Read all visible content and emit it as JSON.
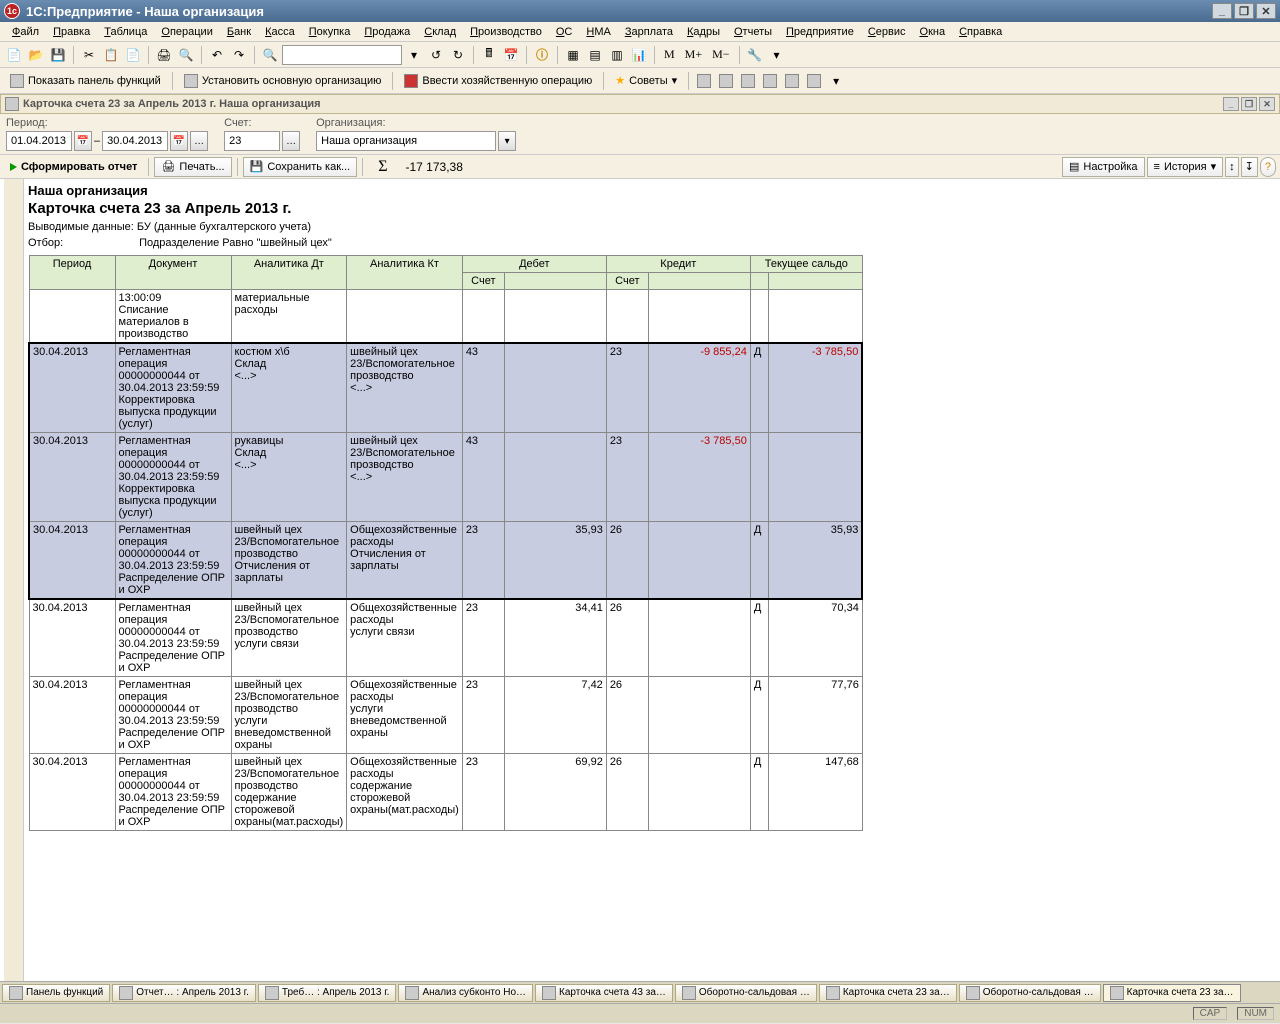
{
  "title": "1С:Предприятие - Наша организация",
  "menu": [
    "Файл",
    "Правка",
    "Таблица",
    "Операции",
    "Банк",
    "Касса",
    "Покупка",
    "Продажа",
    "Склад",
    "Производство",
    "ОС",
    "НМА",
    "Зарплата",
    "Кадры",
    "Отчеты",
    "Предприятие",
    "Сервис",
    "Окна",
    "Справка"
  ],
  "toolbar2": {
    "b1": "Показать панель функций",
    "b2": "Установить основную организацию",
    "b3": "Ввести хозяйственную операцию",
    "b4": "Советы"
  },
  "subtitle": "Карточка счета 23 за Апрель 2013 г. Наша организация",
  "params": {
    "periodLabel": "Период:",
    "from": "01.04.2013",
    "to": "30.04.2013",
    "accountLabel": "Счет:",
    "account": "23",
    "orgLabel": "Организация:",
    "org": "Наша организация"
  },
  "actions": {
    "form": "Сформировать отчет",
    "print": "Печать...",
    "save": "Сохранить как...",
    "sum": "-17 173,38",
    "settings": "Настройка",
    "history": "История"
  },
  "report": {
    "org": "Наша организация",
    "title": "Карточка счета 23 за Апрель 2013 г.",
    "meta1": "Выводимые данные:   БУ (данные бухгалтерского учета)",
    "filterLabel": "Отбор:",
    "filter": "Подразделение Равно \"швейный цех\""
  },
  "headers": {
    "period": "Период",
    "doc": "Документ",
    "adt": "Аналитика Дт",
    "akt": "Аналитика Кт",
    "debit": "Дебет",
    "credit": "Кредит",
    "bal": "Текущее сальдо",
    "acc": "Счет"
  },
  "rows": [
    {
      "sel": false,
      "period": "",
      "doc": "13:00:09\nСписание материалов в производство",
      "adt": "материальные расходы",
      "akt": "",
      "dacc": "",
      "dval": "",
      "cacc": "",
      "cval": "",
      "bdc": "",
      "bval": ""
    },
    {
      "sel": true,
      "period": "30.04.2013",
      "doc": "Регламентная операция 00000000044 от 30.04.2013 23:59:59\nКорректировка выпуска продукции (услуг)",
      "adt": "костюм х\\б\nСклад\n<...>",
      "akt": "швейный цех\n23/Вспомогательное прозводство\n<...>",
      "dacc": "43",
      "dval": "",
      "cacc": "23",
      "cval": "-9 855,24",
      "bdc": "Д",
      "bval": "-3 785,50",
      "neg": true
    },
    {
      "sel": true,
      "period": "30.04.2013",
      "doc": "Регламентная операция 00000000044 от 30.04.2013 23:59:59\nКорректировка выпуска продукции (услуг)",
      "adt": "рукавицы\nСклад\n<...>",
      "akt": "швейный цех\n23/Вспомогательное прозводство\n<...>",
      "dacc": "43",
      "dval": "",
      "cacc": "23",
      "cval": "-3 785,50",
      "bdc": "",
      "bval": "",
      "neg": true
    },
    {
      "sel": true,
      "period": "30.04.2013",
      "doc": "Регламентная операция 00000000044 от 30.04.2013 23:59:59\nРаспределение ОПР и ОХР",
      "adt": "швейный цех\n23/Вспомогательное прозводство\nОтчисления от зарплаты",
      "akt": "Общехозяйственные расходы\nОтчисления от зарплаты",
      "dacc": "23",
      "dval": "35,93",
      "cacc": "26",
      "cval": "",
      "bdc": "Д",
      "bval": "35,93"
    },
    {
      "sel": false,
      "period": "30.04.2013",
      "doc": "Регламентная операция 00000000044 от 30.04.2013 23:59:59\nРаспределение ОПР и ОХР",
      "adt": "швейный цех\n23/Вспомогательное прозводство\nуслуги связи",
      "akt": "Общехозяйственные расходы\nуслуги связи",
      "dacc": "23",
      "dval": "34,41",
      "cacc": "26",
      "cval": "",
      "bdc": "Д",
      "bval": "70,34"
    },
    {
      "sel": false,
      "period": "30.04.2013",
      "doc": "Регламентная операция 00000000044 от 30.04.2013 23:59:59\nРаспределение ОПР и ОХР",
      "adt": "швейный цех\n23/Вспомогательное прозводство\nуслуги вневедомственной охраны",
      "akt": "Общехозяйственные расходы\nуслуги вневедомственной охраны",
      "dacc": "23",
      "dval": "7,42",
      "cacc": "26",
      "cval": "",
      "bdc": "Д",
      "bval": "77,76"
    },
    {
      "sel": false,
      "period": "30.04.2013",
      "doc": "Регламентная операция 00000000044 от 30.04.2013 23:59:59\nРаспределение ОПР и ОХР",
      "adt": "швейный цех\n23/Вспомогательное прозводство\nсодержание сторожевой охраны(мат.расходы)",
      "akt": "Общехозяйственные расходы\nсодержание сторожевой охраны(мат.расходы)",
      "dacc": "23",
      "dval": "69,92",
      "cacc": "26",
      "cval": "",
      "bdc": "Д",
      "bval": "147,68"
    }
  ],
  "taskbar": [
    "Панель функций",
    "Отчет… : Апрель 2013 г.",
    "Треб… : Апрель 2013 г.",
    "Анализ субконто Но…",
    "Карточка счета 43 за…",
    "Оборотно-сальдовая …",
    "Карточка счета 23 за…",
    "Оборотно-сальдовая …",
    "Карточка счета 23 за…"
  ],
  "status": {
    "cap": "CAP",
    "num": "NUM"
  }
}
